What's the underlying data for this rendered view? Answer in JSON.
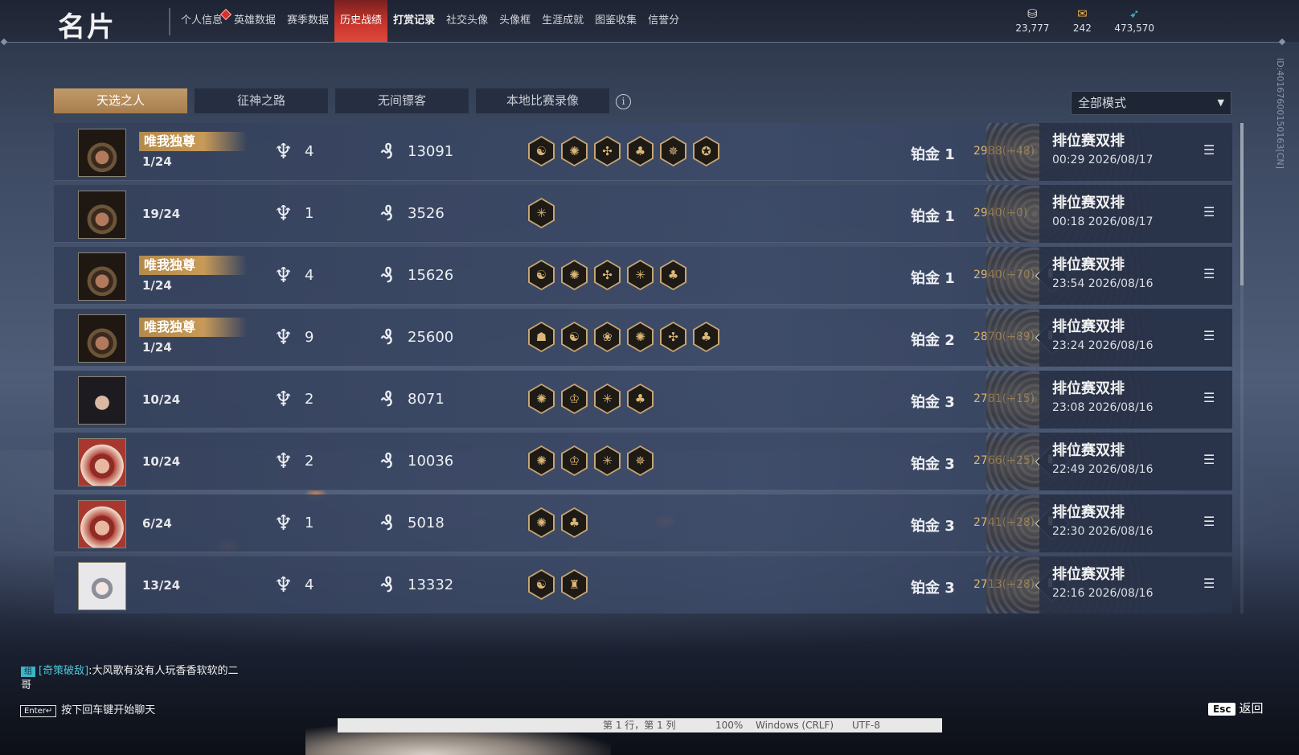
{
  "header": {
    "title": "名片",
    "nav_tabs": [
      "个人信息",
      "英雄数据",
      "赛季数据",
      "历史战绩",
      "打赏记录",
      "社交头像",
      "头像框",
      "生涯成就",
      "图鉴收集",
      "信誉分"
    ],
    "active_tab": "历史战绩",
    "currencies": [
      {
        "icon": "coin-pile-icon",
        "value": "23,777"
      },
      {
        "icon": "ticket-icon",
        "value": "242"
      },
      {
        "icon": "feather-icon",
        "value": "473,570"
      }
    ]
  },
  "side_id": "ID:4016760015016​3[CN]",
  "subtabs": [
    "天选之人",
    "征神之路",
    "无间镖客",
    "本地比赛录像"
  ],
  "active_subtab": "天选之人",
  "mode_filter": {
    "value": "全部模式"
  },
  "matches": [
    {
      "avatar": "hat-hero",
      "badge": "唯我独尊",
      "placement": "1/24",
      "kills": "4",
      "damage": "13091",
      "achievements": [
        "☯",
        "✺",
        "✣",
        "♣",
        "✵",
        "✪"
      ],
      "rank": "铂金 1",
      "points": "2988(+48)",
      "has_stats": false,
      "mode": "排位赛双排",
      "time": "00:29 2026/08/17"
    },
    {
      "avatar": "hat-hero",
      "badge": "",
      "placement": "19/24",
      "kills": "1",
      "damage": "3526",
      "achievements": [
        "✳"
      ],
      "rank": "铂金 1",
      "points": "2940(+0)",
      "has_stats": false,
      "mode": "排位赛双排",
      "time": "00:18 2026/08/17"
    },
    {
      "avatar": "hat-hero",
      "badge": "唯我独尊",
      "placement": "1/24",
      "kills": "4",
      "damage": "15626",
      "achievements": [
        "☯",
        "✺",
        "✣",
        "✳",
        "♣"
      ],
      "rank": "铂金 1",
      "points": "2940(+70)",
      "has_stats": true,
      "mode": "排位赛双排",
      "time": "23:54 2026/08/16"
    },
    {
      "avatar": "hat-hero",
      "badge": "唯我独尊",
      "placement": "1/24",
      "kills": "9",
      "damage": "25600",
      "achievements": [
        "☗",
        "☯",
        "❀",
        "✺",
        "✣",
        "♣"
      ],
      "rank": "铂金 2",
      "points": "2870(+89)",
      "has_stats": true,
      "mode": "排位赛双排",
      "time": "23:24 2026/08/16"
    },
    {
      "avatar": "dark-hair-hero",
      "badge": "",
      "placement": "10/24",
      "kills": "2",
      "damage": "8071",
      "achievements": [
        "✺",
        "♔",
        "✳",
        "♣"
      ],
      "rank": "铂金 3",
      "points": "2781(+15)",
      "has_stats": false,
      "mode": "排位赛双排",
      "time": "23:08 2026/08/16"
    },
    {
      "avatar": "red-hat-hero",
      "badge": "",
      "placement": "10/24",
      "kills": "2",
      "damage": "10036",
      "achievements": [
        "✺",
        "♔",
        "✳",
        "✵"
      ],
      "rank": "铂金 3",
      "points": "2766(+25)",
      "has_stats": true,
      "mode": "排位赛双排",
      "time": "22:49 2026/08/16"
    },
    {
      "avatar": "red-hat-hero",
      "badge": "",
      "placement": "6/24",
      "kills": "1",
      "damage": "5018",
      "achievements": [
        "✺",
        "♣"
      ],
      "rank": "铂金 3",
      "points": "2741(+28)",
      "has_stats": true,
      "mode": "排位赛双排",
      "time": "22:30 2026/08/16"
    },
    {
      "avatar": "white-veil-hero",
      "badge": "",
      "placement": "13/24",
      "kills": "4",
      "damage": "13332",
      "achievements": [
        "☯",
        "♜"
      ],
      "rank": "铂金 3",
      "points": "2713(+28)",
      "has_stats": true,
      "mode": "排位赛双排",
      "time": "22:16 2026/08/16"
    }
  ],
  "chat": {
    "tag": "组",
    "channel": "[奇策破敌]",
    "message": ":大风歌有没有人玩香香软软的二哥",
    "hint_key": "Enter↵",
    "hint": "按下回车键开始聊天"
  },
  "footer": {
    "esc_key": "Esc",
    "back_label": "返回"
  },
  "background_editor": {
    "position": "第 1 行，第 1 列",
    "zoom": "100%",
    "eol": "Windows (CRLF)",
    "encoding": "UTF-8"
  },
  "colors": {
    "active_tab": "#c7352c",
    "active_subtab": "#b08656",
    "points": "#e1b56a",
    "chat_name": "#4fc4d8"
  }
}
